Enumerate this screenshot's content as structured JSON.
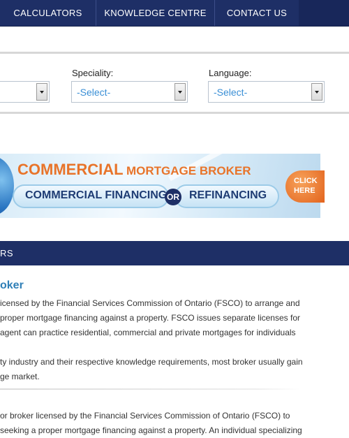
{
  "nav": {
    "items": [
      "CALCULATORS",
      "KNOWLEDGE CENTRE",
      "CONTACT US"
    ]
  },
  "filters": {
    "first_select_value": "",
    "speciality_label": "Speciality:",
    "speciality_value": "-Select-",
    "language_label": "Language:",
    "language_value": "-Select-"
  },
  "banner": {
    "title_big": "COMMERCIAL",
    "title_small": "MORTGAGE BROKER",
    "pill_left": "COMMERCIAL FINANCING",
    "or": "OR",
    "pill_right": "REFINANCING",
    "click_line1": "CLICK",
    "click_line2": "HERE"
  },
  "section": {
    "bar_label": "RS",
    "heading": "oker",
    "para1": [
      "icensed by the Financial Services Commission of Ontario (FSCO) to arrange and",
      "proper mortgage financing against a property. FSCO issues separate licenses for",
      "agent can practice residential, commercial and private mortgages for individuals"
    ],
    "para2": [
      "ty industry and their respective knowledge requirements, most broker usually gain",
      "ge market."
    ],
    "para3": [
      "or broker licensed by the Financial Services Commission of Ontario (FSCO) to",
      "seeking a proper mortgage financing against a property. An individual specializing"
    ]
  },
  "colors": {
    "navy": "#1e2f66",
    "accent_orange": "#e8742a",
    "link_blue": "#2f7fb7"
  }
}
